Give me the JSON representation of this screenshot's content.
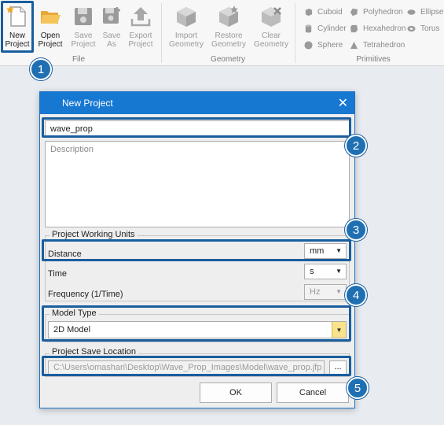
{
  "ribbon": {
    "file": {
      "group_label": "File",
      "new_project": "New\nProject",
      "open_project": "Open\nProject",
      "save_project": "Save\nProject",
      "save_as": "Save\nAs",
      "export_project": "Export\nProject"
    },
    "geometry": {
      "group_label": "Geometry",
      "import_geometry": "Import\nGeometry",
      "restore_geometry": "Restore\nGeometry",
      "clear_geometry": "Clear\nGeometry"
    },
    "primitives": {
      "group_label": "Primitives",
      "items": [
        "Cuboid",
        "Polyhedron",
        "Ellipse",
        "Cylinder",
        "Hexahedron",
        "Torus",
        "Sphere",
        "Tetrahedron"
      ]
    }
  },
  "badges": [
    "1",
    "2",
    "3",
    "4",
    "5"
  ],
  "dialog": {
    "title": "New Project",
    "name_value": "wave_prop",
    "description_placeholder": "Description",
    "units_group": "Project Working Units",
    "distance_label": "Distance",
    "distance_value": "mm",
    "time_label": "Time",
    "time_value": "s",
    "frequency_label": "Frequency (1/Time)",
    "frequency_value": "Hz",
    "model_type_group": "Model Type",
    "model_type_value": "2D Model",
    "save_location_group": "Project Save Location",
    "save_location_value": "C:\\Users\\omashari\\Desktop\\Wave_Prop_Images\\Model\\wave_prop.jfp",
    "browse_label": "...",
    "ok_label": "OK",
    "cancel_label": "Cancel"
  },
  "colors": {
    "accent": "#1778d2",
    "highlight": "#1a5e9e",
    "badge": "#1f6fb3"
  }
}
